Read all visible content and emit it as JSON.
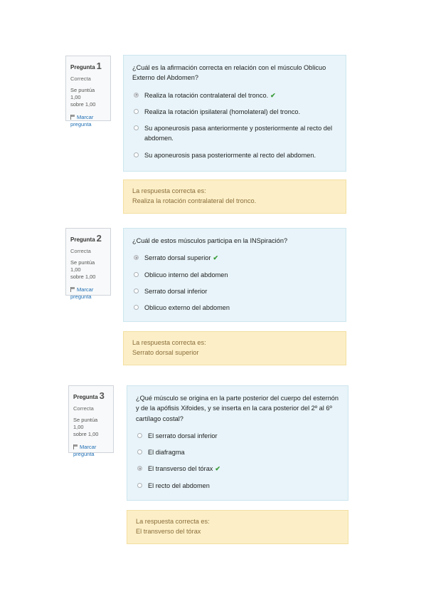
{
  "questions": [
    {
      "label": "Pregunta",
      "number": "1",
      "state": "Correcta",
      "grade_line1": "Se puntúa 1,00",
      "grade_line2": "sobre 1,00",
      "flag_label": "Marcar pregunta",
      "text": "¿Cuál es la afirmación correcta en relación con el músculo Oblicuo Externo del Abdomen?",
      "options": [
        {
          "text": "Realiza la rotación contralateral del tronco.",
          "selected": true,
          "correct": true
        },
        {
          "text": "Realiza la rotación ipsilateral (homolateral) del tronco.",
          "selected": false,
          "correct": false
        },
        {
          "text": "Su aponeurosis pasa anteriormente y posteriormente al recto del abdomen.",
          "selected": false,
          "correct": false
        },
        {
          "text": "Su aponeurosis pasa posteriormente al recto del abdomen.",
          "selected": false,
          "correct": false
        }
      ],
      "feedback_title": "La respuesta correcta es:",
      "feedback_answer": "Realiza la rotación contralateral del tronco."
    },
    {
      "label": "Pregunta",
      "number": "2",
      "state": "Correcta",
      "grade_line1": "Se puntúa 1,00",
      "grade_line2": "sobre 1,00",
      "flag_label": "Marcar pregunta",
      "text": "¿Cuál de estos músculos participa en la INSpiración?",
      "options": [
        {
          "text": "Serrato dorsal superior",
          "selected": true,
          "correct": true
        },
        {
          "text": "Oblicuo interno del abdomen",
          "selected": false,
          "correct": false
        },
        {
          "text": "Serrato dorsal inferior",
          "selected": false,
          "correct": false
        },
        {
          "text": "Oblicuo externo del abdomen",
          "selected": false,
          "correct": false
        }
      ],
      "feedback_title": "La respuesta correcta es:",
      "feedback_answer": "Serrato dorsal superior"
    },
    {
      "label": "Pregunta",
      "number": "3",
      "state": "Correcta",
      "grade_line1": "Se puntúa 1,00",
      "grade_line2": "sobre 1,00",
      "flag_label": "Marcar pregunta",
      "text": "¿Qué músculo se origina en la parte posterior del cuerpo del esternón y de la apófisis Xifoides, y se inserta en la cara posterior del 2º al 6º cartílago costal?",
      "options": [
        {
          "text": "El serrato dorsal inferior",
          "selected": false,
          "correct": false
        },
        {
          "text": "El diafragma",
          "selected": false,
          "correct": false
        },
        {
          "text": "El transverso del tórax",
          "selected": true,
          "correct": true
        },
        {
          "text": "El recto del abdomen",
          "selected": false,
          "correct": false
        }
      ],
      "feedback_title": "La respuesta correcta es:",
      "feedback_answer": "El transverso del tórax"
    }
  ],
  "icons": {
    "correct": "check-icon",
    "flag": "flag-icon"
  },
  "colors": {
    "question_bg": "#e8f4f9",
    "feedback_bg": "#fcefc7",
    "correct_check": "#3a9b3a",
    "link": "#1f6fb5"
  }
}
